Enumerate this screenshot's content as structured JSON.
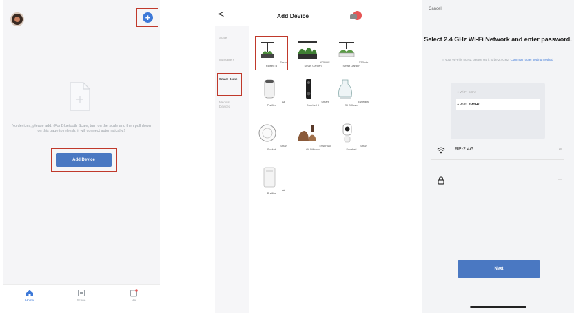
{
  "screen1": {
    "empty_text": "No devices, please add. (For Bluetooth Scale, turn on the scale and then pull down on this page to refresh, it will connect automatically.)",
    "add_device_label": "Add Device",
    "plus_symbol": "+",
    "tabs": [
      {
        "label": "Home",
        "icon": "home-icon"
      },
      {
        "label": "Scene",
        "icon": "scene-icon"
      },
      {
        "label": "Me",
        "icon": "me-icon"
      }
    ]
  },
  "screen2": {
    "title": "Add Device",
    "back_symbol": "<",
    "categories": [
      "Scale",
      "Massagers",
      "Smart Home",
      "Medical Devices"
    ],
    "devices": [
      {
        "label": "Smart Raised B",
        "icon": "smart-garden-icon"
      },
      {
        "label": "XGBOS Smart Garden",
        "icon": "garden-icon"
      },
      {
        "label": "12Pods Smart Garden",
        "icon": "garden-pods-icon"
      },
      {
        "label": "Air Purifier",
        "icon": "air-purifier-icon"
      },
      {
        "label": "Smart Doorbell II",
        "icon": "doorbell-icon"
      },
      {
        "label": "Essential Oil Diffuser",
        "icon": "diffuser-icon"
      },
      {
        "label": "Smart Socket",
        "icon": "socket-icon"
      },
      {
        "label": "Essential Oil Diffuser",
        "icon": "wood-diffuser-icon"
      },
      {
        "label": "Smart Doorbell",
        "icon": "camera-icon"
      },
      {
        "label": "Air Purifier",
        "icon": "tower-purifier-icon"
      }
    ]
  },
  "screen3": {
    "cancel": "Cancel",
    "headline": "Select 2.4 GHz Wi-Fi Network and enter password.",
    "hint": "If your Wi-Fi is 5GHz, please set it to be 2.4GHz.",
    "hint_link": "Common router setting method",
    "band_rows": [
      {
        "label": "Wi-Fi",
        "value": "5Ghz"
      },
      {
        "label": "Wi-Fi",
        "value": "2.4GHz"
      }
    ],
    "wifi_name": "RP-2.4G",
    "password": "",
    "next_label": "Next"
  },
  "colors": {
    "accent": "#4a78c2",
    "highlight_box": "#c0392b"
  }
}
